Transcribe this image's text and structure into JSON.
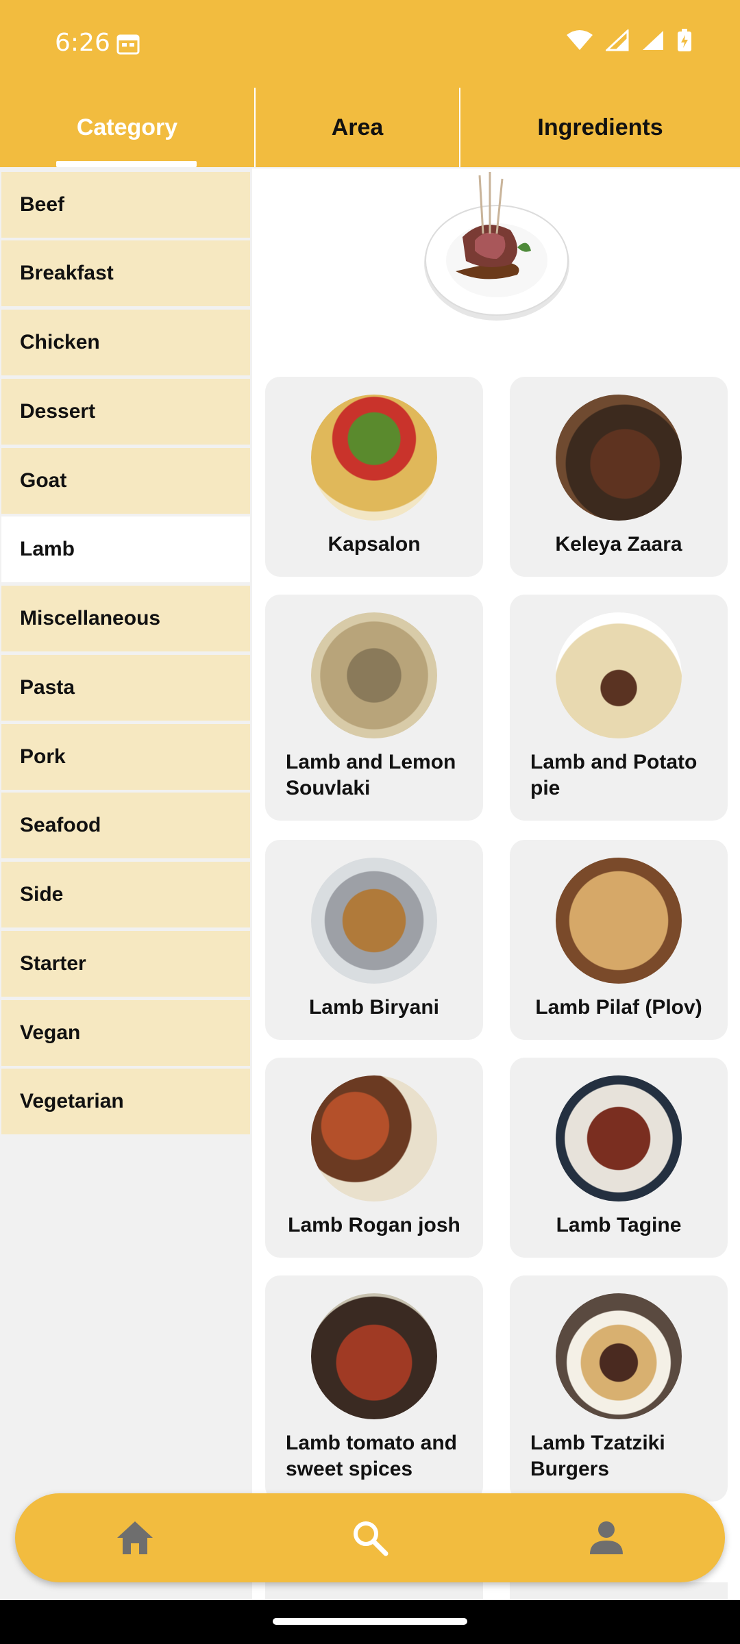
{
  "status_bar": {
    "time": "6:26"
  },
  "tabs": [
    {
      "label": "Category",
      "selected": true
    },
    {
      "label": "Area",
      "selected": false
    },
    {
      "label": "Ingredients",
      "selected": false
    }
  ],
  "categories": [
    {
      "label": "Beef",
      "selected": false
    },
    {
      "label": "Breakfast",
      "selected": false
    },
    {
      "label": "Chicken",
      "selected": false
    },
    {
      "label": "Dessert",
      "selected": false
    },
    {
      "label": "Goat",
      "selected": false
    },
    {
      "label": "Lamb",
      "selected": true
    },
    {
      "label": "Miscellaneous",
      "selected": false
    },
    {
      "label": "Pasta",
      "selected": false
    },
    {
      "label": "Pork",
      "selected": false
    },
    {
      "label": "Seafood",
      "selected": false
    },
    {
      "label": "Side",
      "selected": false
    },
    {
      "label": "Starter",
      "selected": false
    },
    {
      "label": "Vegan",
      "selected": false
    },
    {
      "label": "Vegetarian",
      "selected": false
    }
  ],
  "meals": [
    {
      "name": "Kapsalon"
    },
    {
      "name": "Keleya Zaara"
    },
    {
      "name": "Lamb and Lemon Souvlaki"
    },
    {
      "name": "Lamb and Potato pie"
    },
    {
      "name": "Lamb Biryani"
    },
    {
      "name": "Lamb Pilaf (Plov)"
    },
    {
      "name": "Lamb Rogan josh"
    },
    {
      "name": "Lamb Tagine"
    },
    {
      "name": "Lamb tomato and sweet spices"
    },
    {
      "name": "Lamb Tzatziki Burgers"
    }
  ],
  "bottom_nav": {
    "items": [
      {
        "icon": "home-icon",
        "selected": false
      },
      {
        "icon": "search-icon",
        "selected": true
      },
      {
        "icon": "person-icon",
        "selected": false
      }
    ]
  },
  "colors": {
    "accent": "#f2bc3f",
    "category_bg": "#f6e8c1",
    "card_bg": "#f0f0f0"
  }
}
